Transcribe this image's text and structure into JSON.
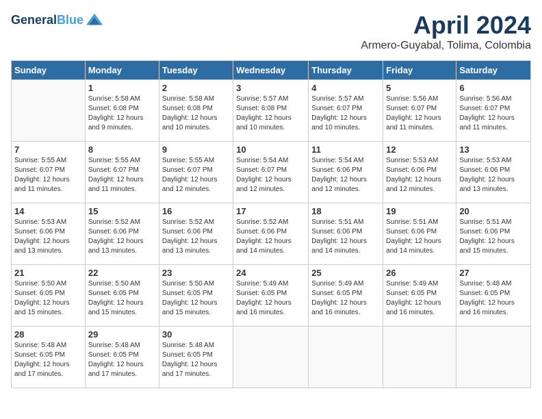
{
  "header": {
    "logo_line1": "General",
    "logo_line2": "Blue",
    "month": "April 2024",
    "location": "Armero-Guyabal, Tolima, Colombia"
  },
  "weekdays": [
    "Sunday",
    "Monday",
    "Tuesday",
    "Wednesday",
    "Thursday",
    "Friday",
    "Saturday"
  ],
  "weeks": [
    [
      {
        "day": "",
        "info": ""
      },
      {
        "day": "1",
        "info": "Sunrise: 5:58 AM\nSunset: 6:08 PM\nDaylight: 12 hours\nand 9 minutes."
      },
      {
        "day": "2",
        "info": "Sunrise: 5:58 AM\nSunset: 6:08 PM\nDaylight: 12 hours\nand 10 minutes."
      },
      {
        "day": "3",
        "info": "Sunrise: 5:57 AM\nSunset: 6:08 PM\nDaylight: 12 hours\nand 10 minutes."
      },
      {
        "day": "4",
        "info": "Sunrise: 5:57 AM\nSunset: 6:07 PM\nDaylight: 12 hours\nand 10 minutes."
      },
      {
        "day": "5",
        "info": "Sunrise: 5:56 AM\nSunset: 6:07 PM\nDaylight: 12 hours\nand 11 minutes."
      },
      {
        "day": "6",
        "info": "Sunrise: 5:56 AM\nSunset: 6:07 PM\nDaylight: 12 hours\nand 11 minutes."
      }
    ],
    [
      {
        "day": "7",
        "info": "Sunrise: 5:55 AM\nSunset: 6:07 PM\nDaylight: 12 hours\nand 11 minutes."
      },
      {
        "day": "8",
        "info": "Sunrise: 5:55 AM\nSunset: 6:07 PM\nDaylight: 12 hours\nand 11 minutes."
      },
      {
        "day": "9",
        "info": "Sunrise: 5:55 AM\nSunset: 6:07 PM\nDaylight: 12 hours\nand 12 minutes."
      },
      {
        "day": "10",
        "info": "Sunrise: 5:54 AM\nSunset: 6:07 PM\nDaylight: 12 hours\nand 12 minutes."
      },
      {
        "day": "11",
        "info": "Sunrise: 5:54 AM\nSunset: 6:06 PM\nDaylight: 12 hours\nand 12 minutes."
      },
      {
        "day": "12",
        "info": "Sunrise: 5:53 AM\nSunset: 6:06 PM\nDaylight: 12 hours\nand 12 minutes."
      },
      {
        "day": "13",
        "info": "Sunrise: 5:53 AM\nSunset: 6:06 PM\nDaylight: 12 hours\nand 13 minutes."
      }
    ],
    [
      {
        "day": "14",
        "info": "Sunrise: 5:53 AM\nSunset: 6:06 PM\nDaylight: 12 hours\nand 13 minutes."
      },
      {
        "day": "15",
        "info": "Sunrise: 5:52 AM\nSunset: 6:06 PM\nDaylight: 12 hours\nand 13 minutes."
      },
      {
        "day": "16",
        "info": "Sunrise: 5:52 AM\nSunset: 6:06 PM\nDaylight: 12 hours\nand 13 minutes."
      },
      {
        "day": "17",
        "info": "Sunrise: 5:52 AM\nSunset: 6:06 PM\nDaylight: 12 hours\nand 14 minutes."
      },
      {
        "day": "18",
        "info": "Sunrise: 5:51 AM\nSunset: 6:06 PM\nDaylight: 12 hours\nand 14 minutes."
      },
      {
        "day": "19",
        "info": "Sunrise: 5:51 AM\nSunset: 6:06 PM\nDaylight: 12 hours\nand 14 minutes."
      },
      {
        "day": "20",
        "info": "Sunrise: 5:51 AM\nSunset: 6:06 PM\nDaylight: 12 hours\nand 15 minutes."
      }
    ],
    [
      {
        "day": "21",
        "info": "Sunrise: 5:50 AM\nSunset: 6:05 PM\nDaylight: 12 hours\nand 15 minutes."
      },
      {
        "day": "22",
        "info": "Sunrise: 5:50 AM\nSunset: 6:05 PM\nDaylight: 12 hours\nand 15 minutes."
      },
      {
        "day": "23",
        "info": "Sunrise: 5:50 AM\nSunset: 6:05 PM\nDaylight: 12 hours\nand 15 minutes."
      },
      {
        "day": "24",
        "info": "Sunrise: 5:49 AM\nSunset: 6:05 PM\nDaylight: 12 hours\nand 16 minutes."
      },
      {
        "day": "25",
        "info": "Sunrise: 5:49 AM\nSunset: 6:05 PM\nDaylight: 12 hours\nand 16 minutes."
      },
      {
        "day": "26",
        "info": "Sunrise: 5:49 AM\nSunset: 6:05 PM\nDaylight: 12 hours\nand 16 minutes."
      },
      {
        "day": "27",
        "info": "Sunrise: 5:48 AM\nSunset: 6:05 PM\nDaylight: 12 hours\nand 16 minutes."
      }
    ],
    [
      {
        "day": "28",
        "info": "Sunrise: 5:48 AM\nSunset: 6:05 PM\nDaylight: 12 hours\nand 17 minutes."
      },
      {
        "day": "29",
        "info": "Sunrise: 5:48 AM\nSunset: 6:05 PM\nDaylight: 12 hours\nand 17 minutes."
      },
      {
        "day": "30",
        "info": "Sunrise: 5:48 AM\nSunset: 6:05 PM\nDaylight: 12 hours\nand 17 minutes."
      },
      {
        "day": "",
        "info": ""
      },
      {
        "day": "",
        "info": ""
      },
      {
        "day": "",
        "info": ""
      },
      {
        "day": "",
        "info": ""
      }
    ]
  ]
}
